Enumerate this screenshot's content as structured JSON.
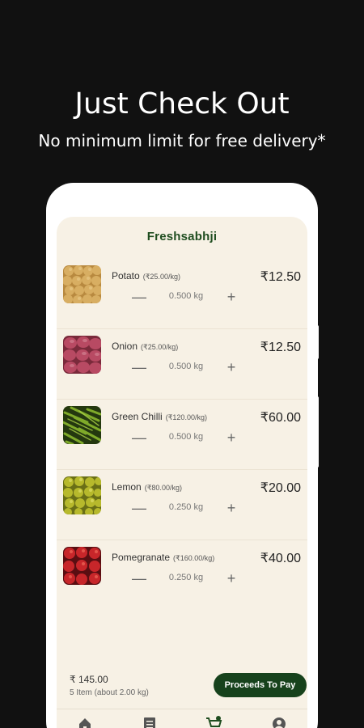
{
  "headline": "Just Check Out",
  "subline": "No minimum limit for free delivery*",
  "app": {
    "title": "Freshsabhji"
  },
  "cart": {
    "items": [
      {
        "name": "Potato",
        "unit_price": "(₹25.00/kg)",
        "qty": "0.500 kg",
        "price": "₹12.50",
        "thumb_icon": "potato-thumbnail"
      },
      {
        "name": "Onion",
        "unit_price": "(₹25.00/kg)",
        "qty": "0.500 kg",
        "price": "₹12.50",
        "thumb_icon": "onion-thumbnail"
      },
      {
        "name": "Green Chilli",
        "unit_price": "(₹120.00/kg)",
        "qty": "0.500 kg",
        "price": "₹60.00",
        "thumb_icon": "green-chilli-thumbnail"
      },
      {
        "name": "Lemon",
        "unit_price": "(₹80.00/kg)",
        "qty": "0.250 kg",
        "price": "₹20.00",
        "thumb_icon": "lemon-thumbnail"
      },
      {
        "name": "Pomegranate",
        "unit_price": "(₹160.00/kg)",
        "qty": "0.250 kg",
        "price": "₹40.00",
        "thumb_icon": "pomegranate-thumbnail"
      }
    ],
    "decrement_symbol": "—",
    "increment_symbol": "+"
  },
  "summary": {
    "total": "₹ 145.00",
    "items_info": "5 Item (about 2.00 kg)",
    "pay_label": "Proceeds To Pay"
  },
  "nav": {
    "items": [
      "home-icon",
      "orders-list-icon",
      "cart-icon",
      "account-icon"
    ],
    "cart_badge": "5"
  },
  "colors": {
    "background": "#111111",
    "screen": "#f7f1e5",
    "accent": "#17421c",
    "title": "#1f4d1f"
  }
}
